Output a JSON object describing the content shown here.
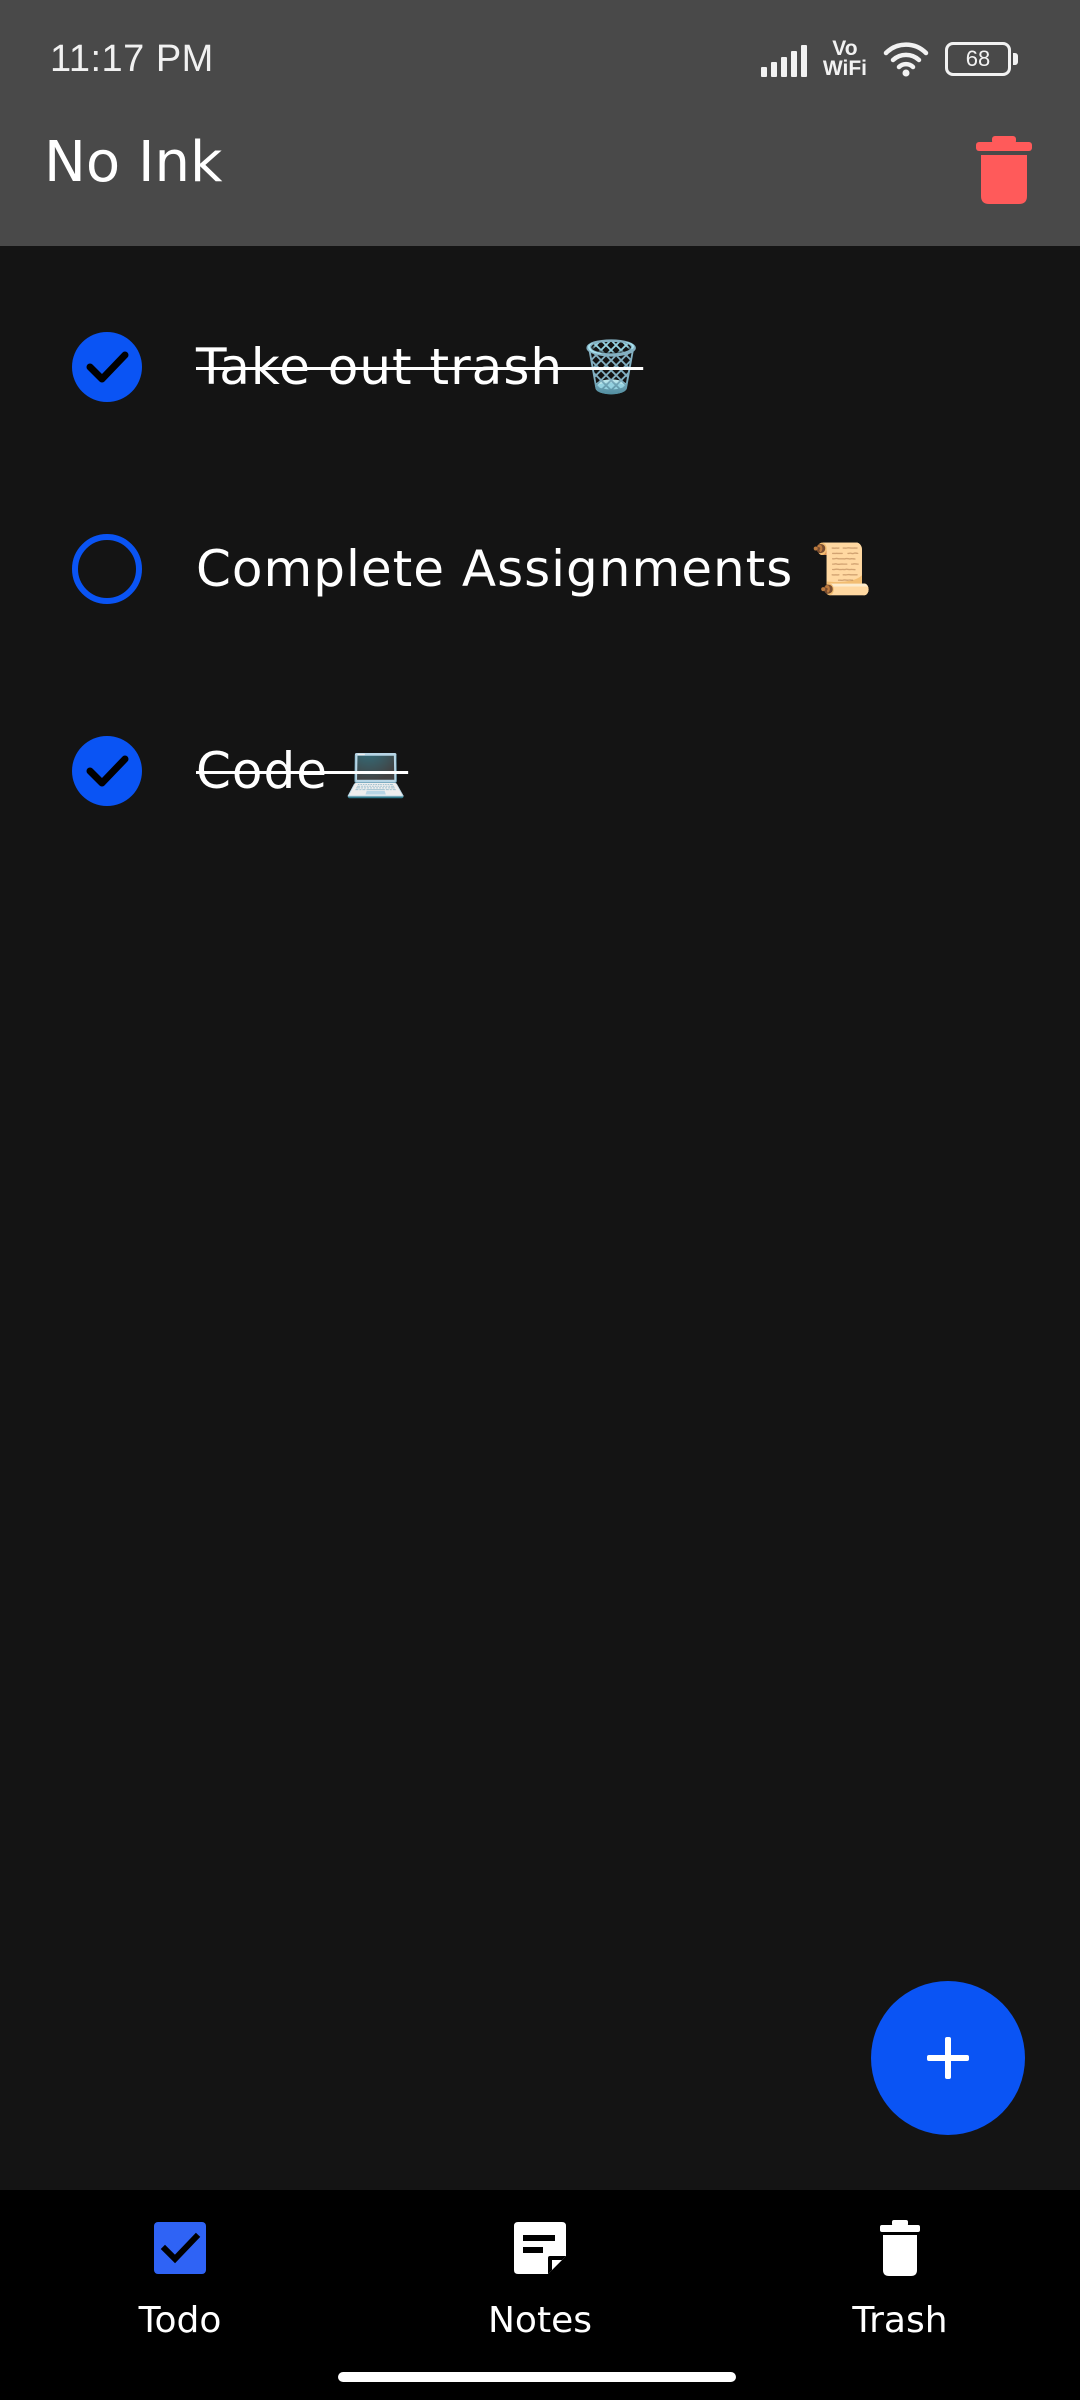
{
  "status_bar": {
    "time": "11:17 PM",
    "network_label_top": "Vo",
    "network_label_bottom": "WiFi",
    "battery": "68"
  },
  "app_bar": {
    "title": "No Ink",
    "delete_icon": "trash-icon",
    "delete_color": "#ff5a5a"
  },
  "todos": [
    {
      "text": "Take out trash 🗑️",
      "done": true
    },
    {
      "text": "Complete Assignments 📜",
      "done": false
    },
    {
      "text": "Code 💻",
      "done": true
    }
  ],
  "fab": {
    "icon": "plus-icon"
  },
  "bottom_nav": {
    "items": [
      {
        "label": "Todo",
        "icon": "checkbox-icon",
        "active": true
      },
      {
        "label": "Notes",
        "icon": "note-icon",
        "active": false
      },
      {
        "label": "Trash",
        "icon": "trash-icon",
        "active": false
      }
    ]
  },
  "colors": {
    "accent": "#0a54f4",
    "background": "#141414",
    "app_bar": "#494949",
    "nav_bar": "#000000",
    "delete": "#ff5a5a"
  }
}
